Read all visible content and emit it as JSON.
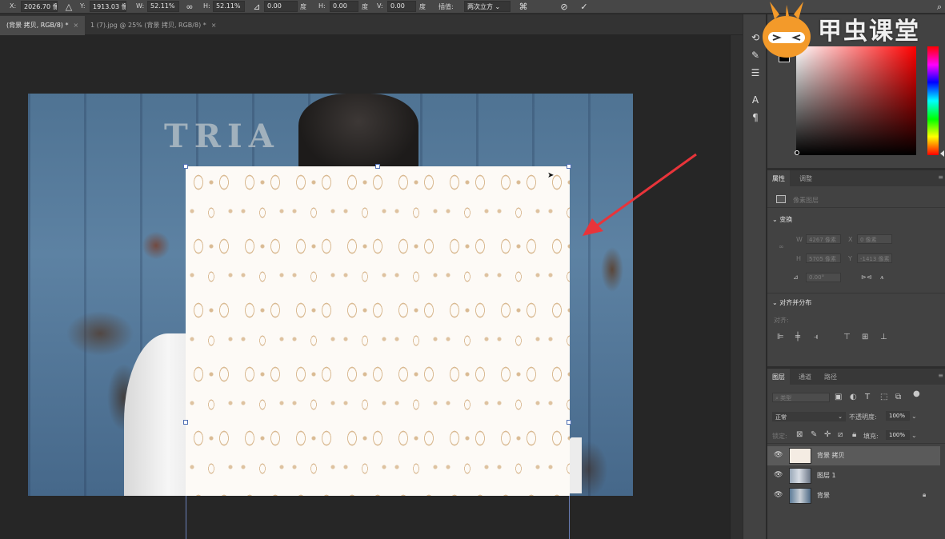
{
  "options_bar": {
    "x_label": "X:",
    "x_value": "2026.70 像",
    "y_label": "Y:",
    "y_value": "1913.03 像",
    "w_label": "W:",
    "w_value": "52.11%",
    "h_label": "H:",
    "h_value": "52.11%",
    "angle_value": "0.00",
    "angle_unit": "度",
    "hskew_label": "H:",
    "hskew_value": "0.00",
    "hskew_unit": "度",
    "vskew_label": "V:",
    "vskew_value": "0.00",
    "vskew_unit": "度",
    "interp_label": "插值:",
    "interp_value": "两次立方"
  },
  "tabs": [
    {
      "label": "(背景 拷贝, RGB/8) *",
      "active": true
    },
    {
      "label": "1 (7).jpg @ 25% (背景 拷贝, RGB/8) *",
      "active": false
    }
  ],
  "canvas": {
    "wall_text": "TRIA"
  },
  "watermark": {
    "brand": "甲虫课堂"
  },
  "properties_panel": {
    "tab_properties": "属性",
    "tab_adjust": "调整",
    "layer_type": "像素图层",
    "transform_title": "变换",
    "w_label": "W",
    "w_value": "4267 像素",
    "x_label": "X",
    "x_value": "0 像素",
    "h_label": "H",
    "h_value": "5705 像素",
    "y_label": "Y",
    "y_value": "-1413 像素",
    "angle_value": "0.00°",
    "align_title": "对齐并分布",
    "align_label": "对齐:"
  },
  "layers_panel": {
    "tab_layers": "图层",
    "tab_channels": "通道",
    "tab_paths": "路径",
    "filter_placeholder": "类型",
    "blend_mode": "正常",
    "opacity_label": "不透明度:",
    "opacity_value": "100%",
    "lock_label": "锁定:",
    "fill_label": "填充:",
    "fill_value": "100%",
    "layers": [
      {
        "name": "背景 拷贝",
        "selected": true
      },
      {
        "name": "图层 1",
        "selected": false
      },
      {
        "name": "背景",
        "selected": false,
        "locked": true
      }
    ]
  },
  "colors": {
    "accent_arrow": "#e8343a",
    "selection": "#4f6fb3",
    "logo_orange": "#f39a2a"
  }
}
